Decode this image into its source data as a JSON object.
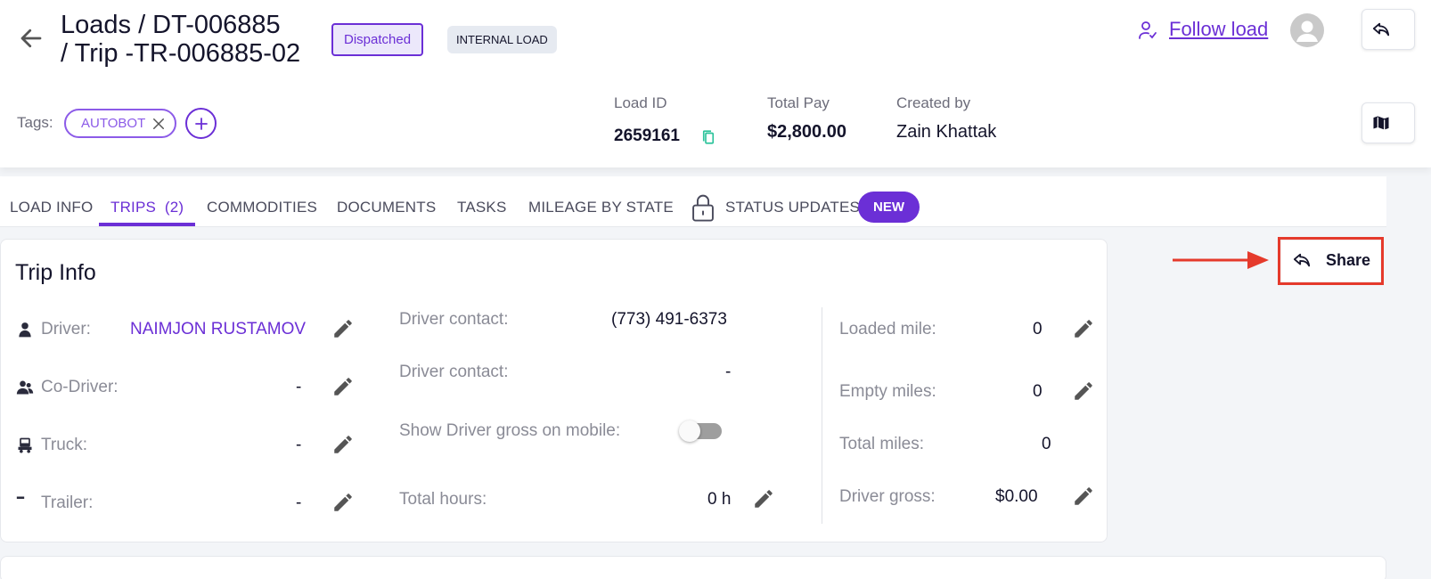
{
  "header": {
    "title_line1": "Loads / DT-006885",
    "title_line2": "/ Trip -TR-006885-02",
    "status_badge": "Dispatched",
    "type_badge": "INTERNAL LOAD",
    "follow_label": "Follow load",
    "tags_label": "Tags:",
    "tags": [
      "AUTOBOT"
    ],
    "load_id_label": "Load ID",
    "load_id": "2659161",
    "total_pay_label": "Total Pay",
    "total_pay": "$2,800.00",
    "created_by_label": "Created by",
    "created_by": "Zain Khattak"
  },
  "tabs": [
    {
      "label": "LOAD INFO"
    },
    {
      "label": "TRIPS  (2)",
      "active": true
    },
    {
      "label": "COMMODITIES"
    },
    {
      "label": "DOCUMENTS"
    },
    {
      "label": "TASKS"
    },
    {
      "label": "MILEAGE BY STATE"
    },
    {
      "label": "STATUS UPDATES",
      "badge": "NEW"
    }
  ],
  "trip_info": {
    "title": "Trip Info",
    "left": [
      {
        "label": "Driver:",
        "value": "NAIMJON RUSTAMOV",
        "icon": "person-icon"
      },
      {
        "label": "Co-Driver:",
        "value": "-",
        "icon": "people-icon"
      },
      {
        "label": "Truck:",
        "value": "-",
        "icon": "truck-icon"
      },
      {
        "label": "Trailer:",
        "value": "-",
        "icon": "trailer-icon"
      }
    ],
    "middle": [
      {
        "label": "Driver contact:",
        "value": "(773) 491-6373"
      },
      {
        "label": "Driver contact:",
        "value": "-"
      },
      {
        "label": "Show Driver gross on mobile:",
        "toggle": false
      },
      {
        "label": "Total hours:",
        "value": "0 h"
      }
    ],
    "right": [
      {
        "label": "Loaded mile:",
        "value": "0"
      },
      {
        "label": "Empty miles:",
        "value": "0"
      },
      {
        "label": "Total miles:",
        "value": "0"
      },
      {
        "label": "Driver gross:",
        "value": "$0.00"
      }
    ]
  },
  "share_label": "Share",
  "colors": {
    "accent": "#6b2fd6",
    "highlight": "#e53a2c",
    "copy": "#2cc39b"
  }
}
